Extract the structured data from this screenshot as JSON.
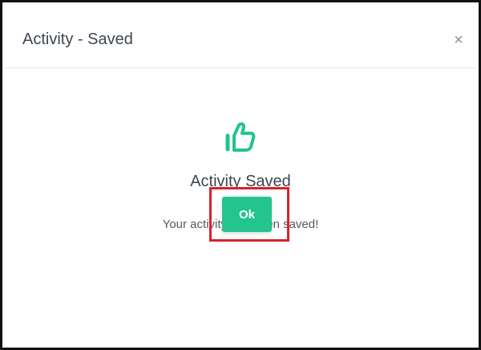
{
  "modal": {
    "title": "Activity - Saved",
    "close_label": "×",
    "icon": "thumbs-up-icon",
    "heading": "Activity Saved",
    "message": "Your activity has been saved!",
    "ok_label": "Ok"
  },
  "colors": {
    "accent": "#23c48e",
    "highlight": "#d9212e",
    "text_dark": "#3f4650",
    "text_muted": "#555b62"
  }
}
